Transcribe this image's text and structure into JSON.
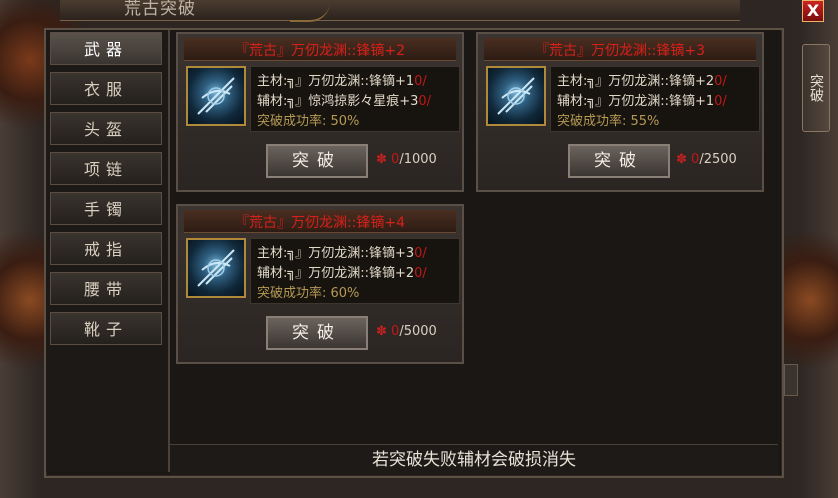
{
  "window": {
    "title": "荒古突破",
    "close_label": "X"
  },
  "side_tab": {
    "label": "突破"
  },
  "categories": [
    {
      "label": "武器",
      "active": true
    },
    {
      "label": "衣服"
    },
    {
      "label": "头盔"
    },
    {
      "label": "项链"
    },
    {
      "label": "手镯"
    },
    {
      "label": "戒指"
    },
    {
      "label": "腰带"
    },
    {
      "label": "靴子"
    }
  ],
  "cards": [
    {
      "title": "『荒古』万仞龙渊::锋镝+2",
      "main_prefix": "主材:",
      "main_material": "╗』万仞龙渊::锋镝+1",
      "main_count": "0/",
      "aux_prefix": "辅材:",
      "aux_material": "╗』惊鸿掠影々星痕+3",
      "aux_count": "0/",
      "rate": "突破成功率: 50%",
      "button": "突破",
      "cost_have": "0",
      "cost_need": "/1000"
    },
    {
      "title": "『荒古』万仞龙渊::锋镝+3",
      "main_prefix": "主材:",
      "main_material": "╗』万仞龙渊::锋镝+2",
      "main_count": "0/",
      "aux_prefix": "辅材:",
      "aux_material": "╗』万仞龙渊::锋镝+1",
      "aux_count": "0/",
      "rate": "突破成功率: 55%",
      "button": "突破",
      "cost_have": "0",
      "cost_need": "/2500"
    },
    {
      "title": "『荒古』万仞龙渊::锋镝+4",
      "main_prefix": "主材:",
      "main_material": "╗』万仞龙渊::锋镝+3",
      "main_count": "0/",
      "aux_prefix": "辅材:",
      "aux_material": "╗』万仞龙渊::锋镝+2",
      "aux_count": "0/",
      "rate": "突破成功率: 60%",
      "button": "突破",
      "cost_have": "0",
      "cost_need": "/5000"
    }
  ],
  "cost_icon": "red-gem-icon",
  "footer": {
    "text": "若突破失败辅材会破损消失"
  },
  "colors": {
    "title_red": "#d8201a",
    "rate_gold": "#b59a55",
    "count_red": "#c01818"
  }
}
